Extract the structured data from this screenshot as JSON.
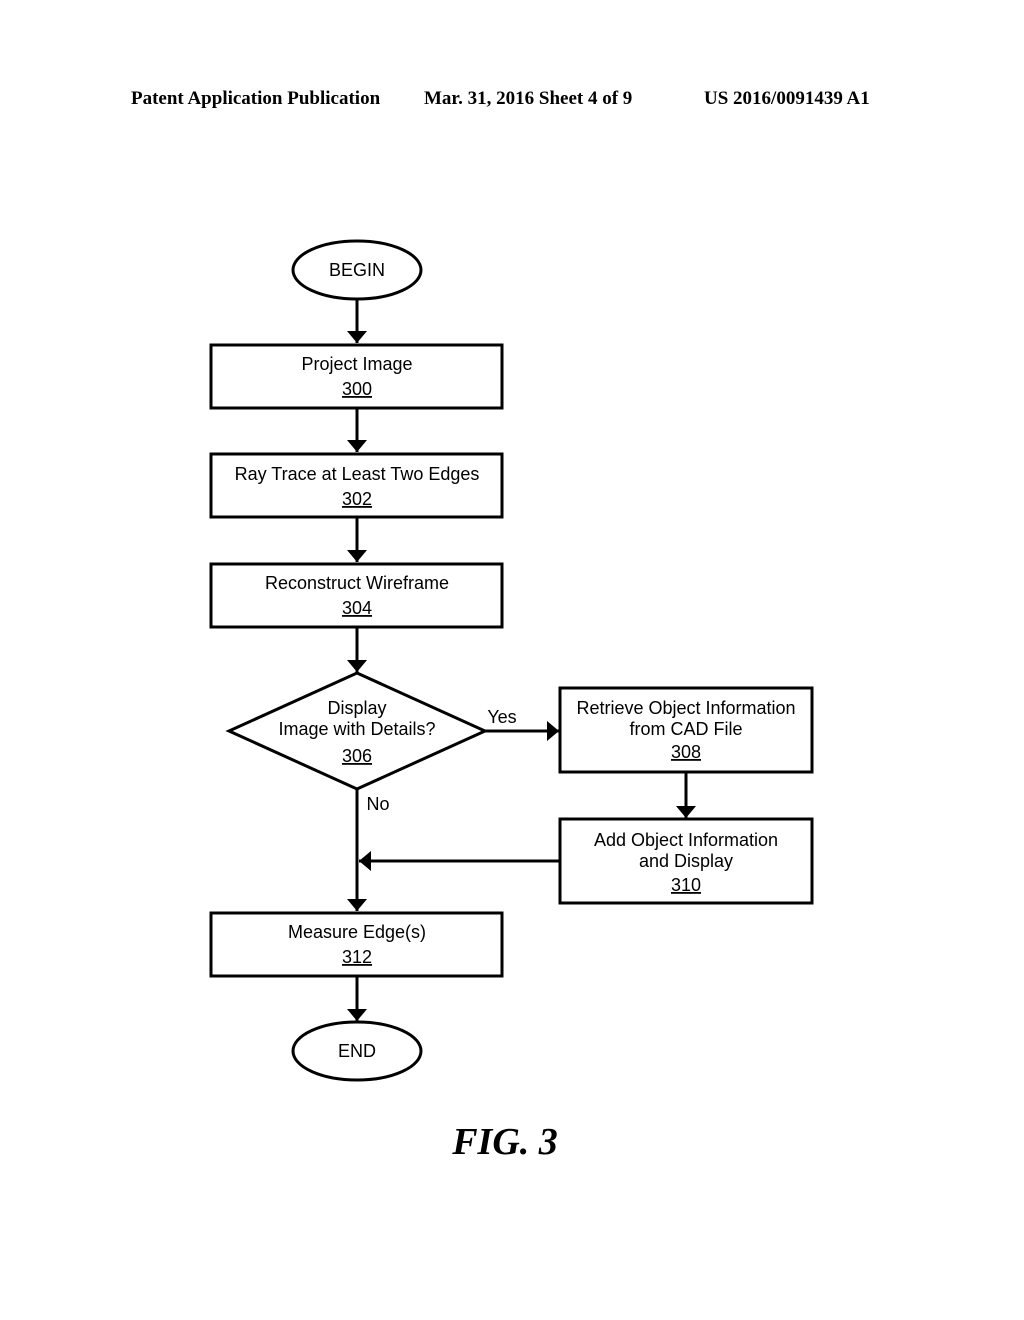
{
  "header": {
    "left": "Patent Application Publication",
    "middle": "Mar. 31, 2016  Sheet 4 of 9",
    "right": "US 2016/0091439 A1"
  },
  "flowchart": {
    "begin": "BEGIN",
    "end": "END",
    "steps": {
      "s300": {
        "line1": "Project Image",
        "ref": "300"
      },
      "s302": {
        "line1": "Ray Trace at Least Two Edges",
        "ref": "302"
      },
      "s304": {
        "line1": "Reconstruct Wireframe",
        "ref": "304"
      },
      "s306": {
        "line1": "Display",
        "line2": "Image with Details?",
        "ref": "306"
      },
      "s308": {
        "line1": "Retrieve Object Information",
        "line2": "from CAD File",
        "ref": "308"
      },
      "s310": {
        "line1": "Add Object Information",
        "line2": "and Display",
        "ref": "310"
      },
      "s312": {
        "line1": "Measure Edge(s)",
        "ref": "312"
      }
    },
    "labels": {
      "yes": "Yes",
      "no": "No"
    }
  },
  "figure_label": "FIG. 3"
}
